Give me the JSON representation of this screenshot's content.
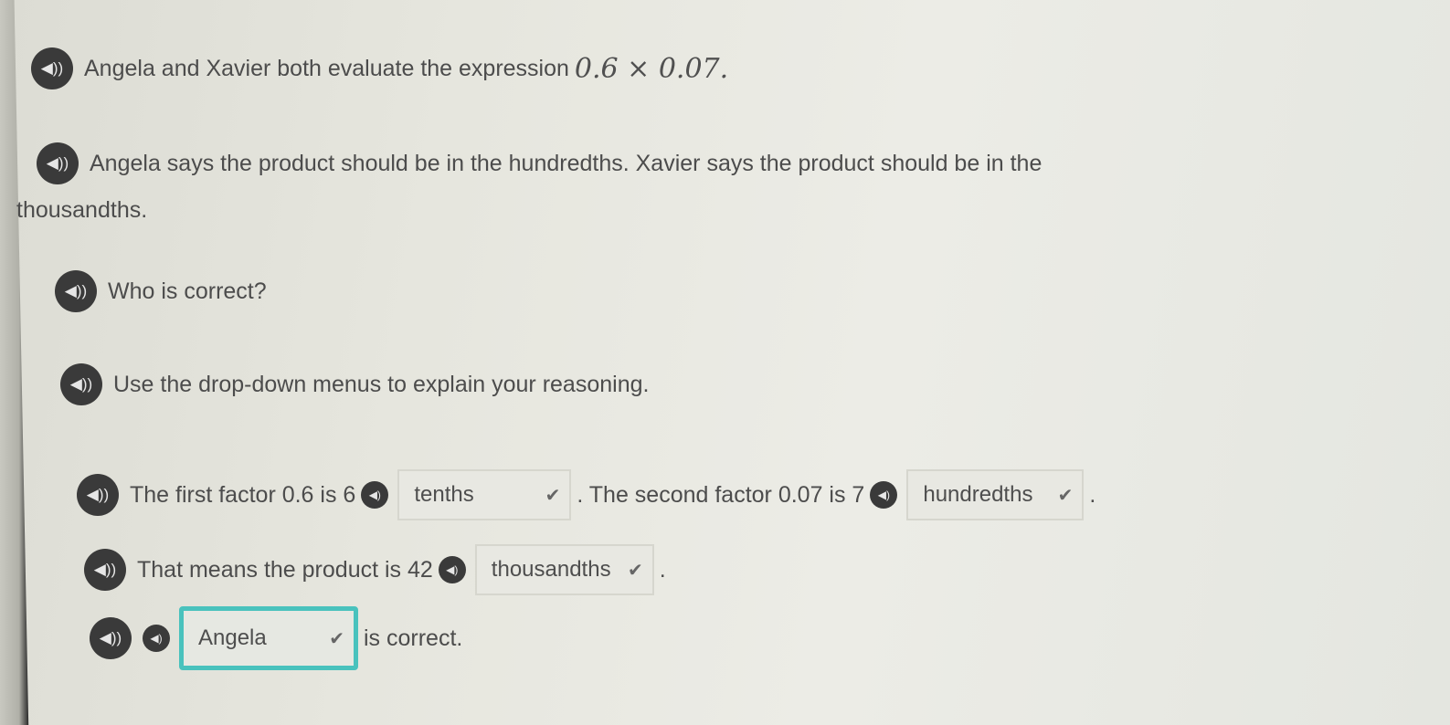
{
  "question": {
    "line1_text": "Angela and Xavier both evaluate the expression",
    "expression": "0.6 × 0.07.",
    "line2_text": "Angela says the product should be in the hundredths. Xavier says the product should be in the",
    "line2_wrap": "thousandths.",
    "line3_text": "Who is correct?",
    "line4_text": "Use the drop-down menus to explain your reasoning."
  },
  "answer": {
    "row1_prefix": "The first factor 0.6 is 6",
    "row1_dropdown": "tenths",
    "row1_middle": ". The second factor 0.07 is 7",
    "row1_dropdown2": "hundredths",
    "row1_end": ".",
    "row2_prefix": "That means the product is 42",
    "row2_dropdown": "thousandths",
    "row2_end": ".",
    "row3_dropdown": "Angela",
    "row3_suffix": "is correct."
  },
  "colors": {
    "active_outline": "#49c2bd",
    "speaker": "#3a3a3a"
  },
  "icons": {
    "speaker": "speaker-icon",
    "chevron": "chevron-down-icon"
  }
}
